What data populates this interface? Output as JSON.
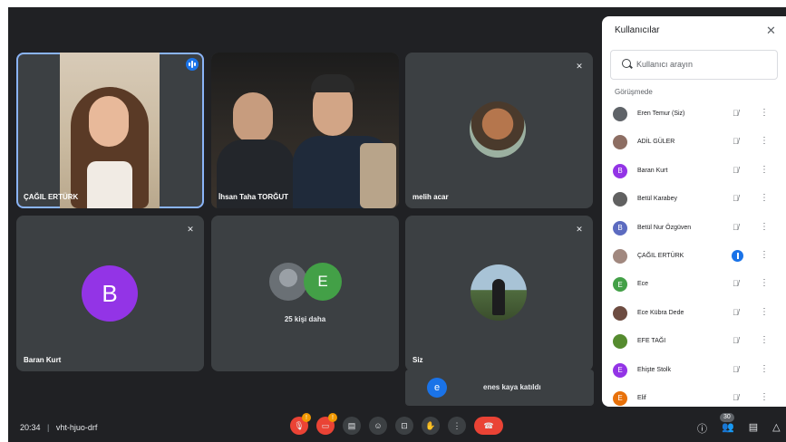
{
  "meeting": {
    "time": "20:34",
    "code": "vht-hjuo-drf"
  },
  "tiles": [
    {
      "name": "ÇAĞIL ERTÜRK"
    },
    {
      "name": "İhsan Taha TORĞUT"
    },
    {
      "name": "melih acar"
    },
    {
      "name": "Baran Kurt",
      "initial": "B"
    },
    {
      "name": "25 kişi daha",
      "initial": "E"
    },
    {
      "name": "Siz"
    }
  ],
  "toast": {
    "initial": "e",
    "text": "enes kaya katıldı"
  },
  "controls": {
    "warning_mark": "!",
    "participant_count": "30"
  },
  "panel": {
    "title": "Kullanıcılar",
    "search_placeholder": "Kullanıcı arayın",
    "section": "Görüşmede",
    "participants": [
      {
        "name": "Eren Temur (Siz)",
        "initial": "",
        "color": "#5f6368"
      },
      {
        "name": "ADİL GÜLER",
        "initial": "",
        "color": "#8d6e63"
      },
      {
        "name": "Baran Kurt",
        "initial": "B",
        "color": "#9334e6"
      },
      {
        "name": "Betül Karabey",
        "initial": "",
        "color": "#616161"
      },
      {
        "name": "Betül Nur Özgüven",
        "initial": "B",
        "color": "#5c6bc0"
      },
      {
        "name": "ÇAĞIL ERTÜRK",
        "initial": "",
        "color": "#a1887f"
      },
      {
        "name": "Ece",
        "initial": "E",
        "color": "#43a047"
      },
      {
        "name": "Ece Kübra Dede",
        "initial": "",
        "color": "#6d4c41"
      },
      {
        "name": "EFE TAĞI",
        "initial": "",
        "color": "#558b2f"
      },
      {
        "name": "Ehişte Stolk",
        "initial": "E",
        "color": "#9334e6"
      },
      {
        "name": "Elif",
        "initial": "E",
        "color": "#e8710a"
      }
    ]
  },
  "colors": {
    "accent": "#1a73e8",
    "end_call": "#ea4335",
    "warning": "#f29900",
    "background": "#202124",
    "tile": "#3c4043"
  }
}
